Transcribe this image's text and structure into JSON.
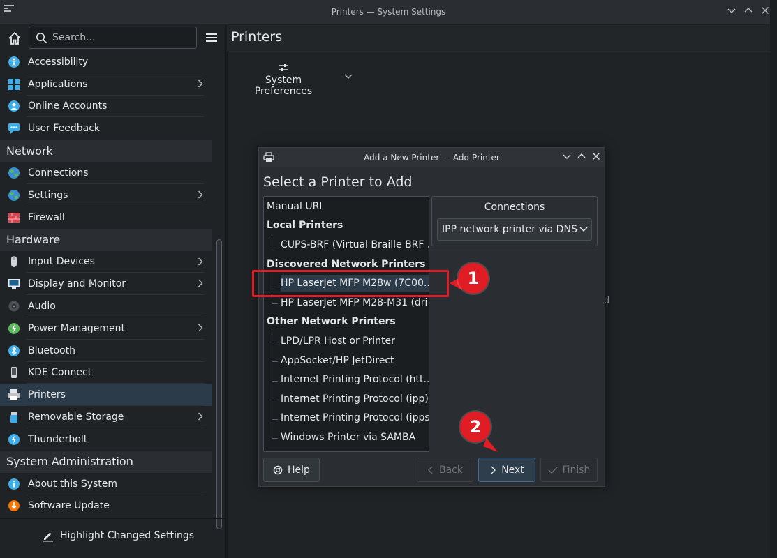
{
  "window": {
    "title": "Printers — System Settings"
  },
  "sidebar": {
    "search_placeholder": "Search...",
    "items": [
      {
        "type": "item",
        "label": "Accessibility",
        "icon": "accessibility-icon",
        "arrow": false
      },
      {
        "type": "item",
        "label": "Applications",
        "icon": "applications-icon",
        "arrow": true
      },
      {
        "type": "item",
        "label": "Online Accounts",
        "icon": "online-accounts-icon",
        "arrow": false
      },
      {
        "type": "item",
        "label": "User Feedback",
        "icon": "user-feedback-icon",
        "arrow": false
      },
      {
        "type": "category",
        "label": "Network"
      },
      {
        "type": "item",
        "label": "Connections",
        "icon": "globe-icon",
        "arrow": false
      },
      {
        "type": "item",
        "label": "Settings",
        "icon": "globe-icon",
        "arrow": true
      },
      {
        "type": "item",
        "label": "Firewall",
        "icon": "firewall-icon",
        "arrow": false
      },
      {
        "type": "category",
        "label": "Hardware"
      },
      {
        "type": "item",
        "label": "Input Devices",
        "icon": "mouse-icon",
        "arrow": true
      },
      {
        "type": "item",
        "label": "Display and Monitor",
        "icon": "monitor-icon",
        "arrow": true
      },
      {
        "type": "item",
        "label": "Audio",
        "icon": "speaker-icon",
        "arrow": false
      },
      {
        "type": "item",
        "label": "Power Management",
        "icon": "power-icon",
        "arrow": true
      },
      {
        "type": "item",
        "label": "Bluetooth",
        "icon": "bluetooth-icon",
        "arrow": false
      },
      {
        "type": "item",
        "label": "KDE Connect",
        "icon": "phone-icon",
        "arrow": false
      },
      {
        "type": "item",
        "label": "Printers",
        "icon": "printer-icon",
        "arrow": false,
        "selected": true
      },
      {
        "type": "item",
        "label": "Removable Storage",
        "icon": "usb-icon",
        "arrow": true
      },
      {
        "type": "item",
        "label": "Thunderbolt",
        "icon": "thunderbolt-icon",
        "arrow": false
      },
      {
        "type": "category",
        "label": "System Administration"
      },
      {
        "type": "item",
        "label": "About this System",
        "icon": "info-icon",
        "arrow": false
      },
      {
        "type": "item",
        "label": "Software Update",
        "icon": "update-icon",
        "arrow": false
      }
    ],
    "footer_label": "Highlight Changed Settings"
  },
  "main": {
    "title": "Printers",
    "system_preferences_label": "System Preferences"
  },
  "dialog": {
    "title": "Add a New Printer — Add Printer",
    "heading": "Select a Printer to Add",
    "printer_list": [
      {
        "kind": "top",
        "label": "Manual URI"
      },
      {
        "kind": "head",
        "label": "Local Printers"
      },
      {
        "kind": "child",
        "label": "CUPS-BRF (Virtual Braille BRF ..."
      },
      {
        "kind": "head",
        "label": "Discovered Network Printers"
      },
      {
        "kind": "child",
        "label": "HP LaserJet MFP M28w (7C00...",
        "selected": true,
        "cont": true
      },
      {
        "kind": "child",
        "label": "HP LaserJet MFP M28-M31 (dri..."
      },
      {
        "kind": "head",
        "label": "Other Network Printers"
      },
      {
        "kind": "child",
        "label": "LPD/LPR Host or Printer",
        "cont": true
      },
      {
        "kind": "child",
        "label": "AppSocket/HP JetDirect",
        "cont": true
      },
      {
        "kind": "child",
        "label": "Internet Printing Protocol (htt...",
        "cont": true
      },
      {
        "kind": "child",
        "label": "Internet Printing Protocol (ipp)",
        "cont": true
      },
      {
        "kind": "child",
        "label": "Internet Printing Protocol (ipps)",
        "cont": true
      },
      {
        "kind": "child",
        "label": "Windows Printer via SAMBA"
      }
    ],
    "connections_label": "Connections",
    "connection_value": "IPP network printer via DNS-S",
    "buttons": {
      "help": "Help",
      "back": "Back",
      "next": "Next",
      "finish": "Finish"
    }
  },
  "annotations": {
    "badge1": "1",
    "badge2": "2",
    "color": "#e01c24"
  },
  "stray_text": "d"
}
